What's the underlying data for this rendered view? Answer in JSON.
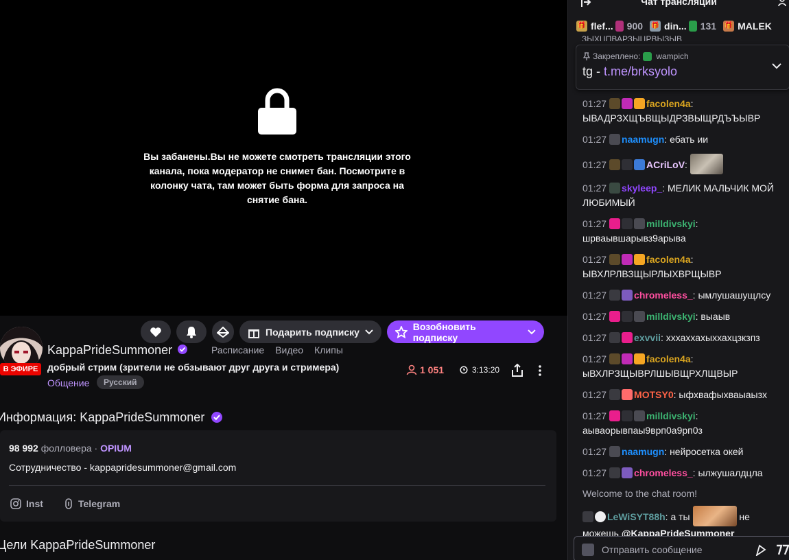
{
  "player": {
    "ban_message": "Вы забанены.Вы не можете смотреть трансляции этого канала, пока модератор не снимет бан. Посмотрите в колонку чата, там может быть форма для запроса на снятие бана."
  },
  "actions": {
    "gift_label": "Подарить подписку",
    "resub_label": "Возобновить подписку"
  },
  "channel": {
    "live_badge": "В ЭФИРЕ",
    "name": "KappaPrideSummoner",
    "tabs": [
      "Расписание",
      "Видео",
      "Клипы"
    ],
    "title": "добрый стрим (зрители не обзывают друг друга и стримера)",
    "category": "Общение",
    "language_tag": "Русский",
    "viewers": "1 051",
    "uptime": "3:13:20"
  },
  "about": {
    "heading": "Информация: KappaPrideSummoner",
    "followers_count": "98 992",
    "followers_label": "фолловера ·",
    "team": "OPIUM",
    "description": "Сотрудничество - kappapridesummoner@gmail.com",
    "socials": [
      "Inst",
      "Telegram"
    ],
    "goals_heading": "Цели KappaPrideSummoner"
  },
  "chat": {
    "title": "Чат трансляции",
    "gifters": [
      {
        "name": "flef...",
        "count": "900"
      },
      {
        "name": "din...",
        "count": "131"
      },
      {
        "name": "MALEK",
        "count": ""
      }
    ],
    "cut_text": "ЗЫХЦПВАРЗЫЦРВЫЗЫВ",
    "pinned": {
      "label": "Закреплено:",
      "by": "wampich",
      "text": "tg -",
      "link": "t.me/brksyolo"
    },
    "messages": [
      {
        "time": "01:27",
        "user": "facolen4a",
        "color": "#daa520",
        "text": "ЫВАДРЗХЩЪВЩЫДРЗВЫЩРДЪЪЫВР",
        "badges": [
          "#5c4a2a",
          "#c02bb6",
          "#f5a623"
        ]
      },
      {
        "time": "01:27",
        "user": "naamugn",
        "color": "#1e90ff",
        "text": "ебать ии",
        "badges": [
          "#4a4a52"
        ]
      },
      {
        "time": "01:27",
        "user": "ACriLoV",
        "color": "#e8c6ff",
        "text": "",
        "badges": [
          "#5c4a2a",
          "#2f2f35",
          "#3c7bd8"
        ],
        "emote": true
      },
      {
        "time": "01:27",
        "user": "skyleep_",
        "color": "#9147ff",
        "text": "МЕЛИК МАЛЬЧИК МОЙ ЛЮБИМЫЙ",
        "badges": [
          "#3a4a42"
        ]
      },
      {
        "time": "01:27",
        "user": "milldivskyi",
        "color": "#3cb371",
        "text": "шрваывшарывз9арыва",
        "badges": [
          "#e91e8c",
          "#2f2f35",
          "#4a4a52"
        ]
      },
      {
        "time": "01:27",
        "user": "facolen4a",
        "color": "#daa520",
        "text": "ЫВХЛРЛВЗЩЫРЛЫХВРЩЫВР",
        "badges": [
          "#5c4a2a",
          "#c02bb6",
          "#f5a623"
        ]
      },
      {
        "time": "01:27",
        "user": "chromeless_",
        "color": "#ff4fa0",
        "text": "ымлушашущлсу",
        "badges": [
          "#3a3a40",
          "#7d5bbe"
        ]
      },
      {
        "time": "01:27",
        "user": "milldivskyi",
        "color": "#3cb371",
        "text": "выаыв",
        "badges": [
          "#e91e8c",
          "#2f2f35",
          "#4a4a52"
        ]
      },
      {
        "time": "01:27",
        "user": "exvvii",
        "color": "#5f9ea0",
        "text": "хххаххахыххахцзкзпз",
        "badges": [
          "#3a3a40",
          "#e91e8c"
        ]
      },
      {
        "time": "01:27",
        "user": "facolen4a",
        "color": "#daa520",
        "text": "ыВХЛРЗЩЫВРЛШЫВЩРХЛЩВЫР",
        "badges": [
          "#5c4a2a",
          "#c02bb6",
          "#f5a623"
        ]
      },
      {
        "time": "01:27",
        "user": "MOTSY0",
        "color": "#ff6347",
        "text": "ыфхвафыхваыаызх",
        "badges": [
          "#3a3a40",
          "#ff6b6b"
        ]
      },
      {
        "time": "01:27",
        "user": "milldivskyi",
        "color": "#3cb371",
        "text": "аываорывпаы9врп0а9рп0з",
        "badges": [
          "#e91e8c",
          "#2f2f35",
          "#4a4a52"
        ]
      },
      {
        "time": "01:27",
        "user": "naamugn",
        "color": "#1e90ff",
        "text": "нейросетка окей",
        "badges": [
          "#4a4a52"
        ]
      },
      {
        "time": "01:27",
        "user": "chromeless_",
        "color": "#ff4fa0",
        "text": "ылжушалдцла",
        "badges": [
          "#3a3a40",
          "#7d5bbe"
        ]
      }
    ],
    "welcome": "Welcome to the chat room!",
    "last_message": {
      "user": "LeWiSYT88h",
      "color": "#5f9ea0",
      "text_before": "а ты",
      "text_after": "не можешь",
      "mention": "@KappaPrideSummoner"
    },
    "input_placeholder": "Отправить сообщение"
  },
  "colors": {
    "accent": "#9147ff",
    "live": "#eb0400",
    "viewers": "#ff8280",
    "link": "#bf94ff"
  }
}
